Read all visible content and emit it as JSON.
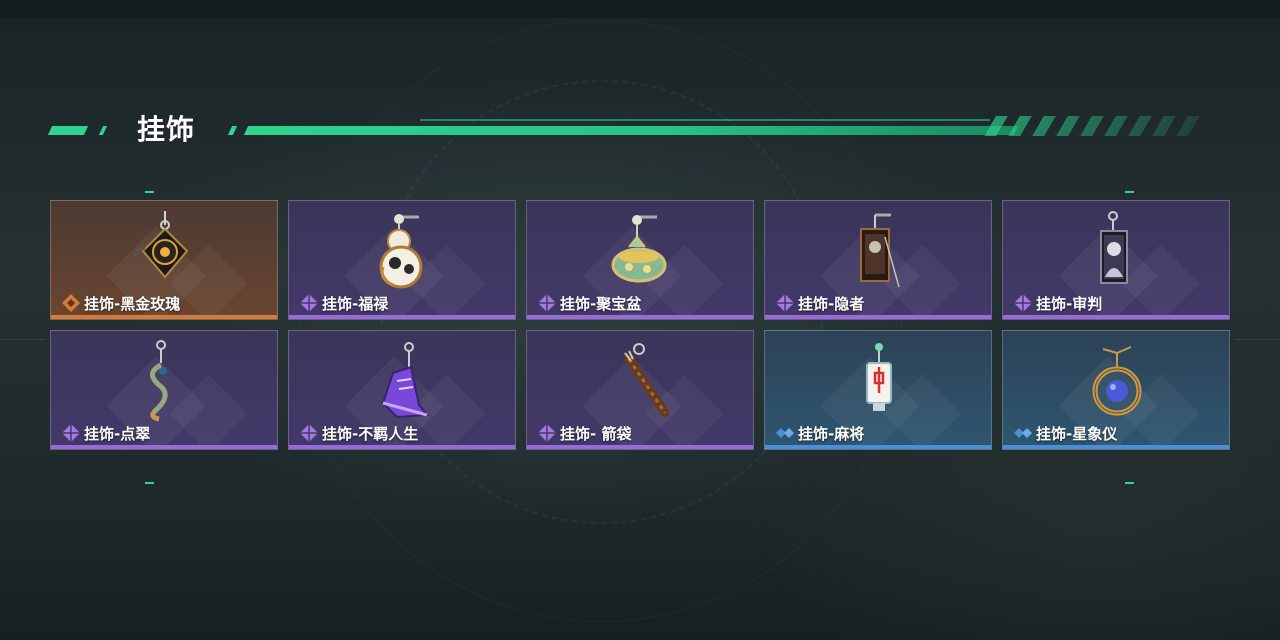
{
  "header": {
    "title": "挂饰"
  },
  "items": [
    {
      "label": "挂饰-黑金玫瑰",
      "rarity": "orange",
      "icon": "black-gold-rose-pendant-icon"
    },
    {
      "label": "挂饰-福禄",
      "rarity": "purple",
      "icon": "gourd-pendant-icon"
    },
    {
      "label": "挂饰-聚宝盆",
      "rarity": "purple",
      "icon": "treasure-bowl-pendant-icon"
    },
    {
      "label": "挂饰-隐者",
      "rarity": "purple",
      "icon": "hermit-card-pendant-icon"
    },
    {
      "label": "挂饰-审判",
      "rarity": "purple",
      "icon": "judgement-card-pendant-icon"
    },
    {
      "label": "挂饰-点翠",
      "rarity": "purple",
      "icon": "kingfisher-pendant-icon"
    },
    {
      "label": "挂饰-不羁人生",
      "rarity": "purple",
      "icon": "sneaker-pendant-icon"
    },
    {
      "label": "挂饰- 箭袋",
      "rarity": "purple",
      "icon": "quiver-pendant-icon"
    },
    {
      "label": "挂饰-麻将",
      "rarity": "blue",
      "icon": "mahjong-tile-pendant-icon"
    },
    {
      "label": "挂饰-星象仪",
      "rarity": "blue",
      "icon": "astrolabe-pendant-icon"
    }
  ],
  "colors": {
    "accent": "#2ed48f",
    "orange": "#d67a3a",
    "purple": "#9a6ad9",
    "blue": "#4a90d9"
  }
}
